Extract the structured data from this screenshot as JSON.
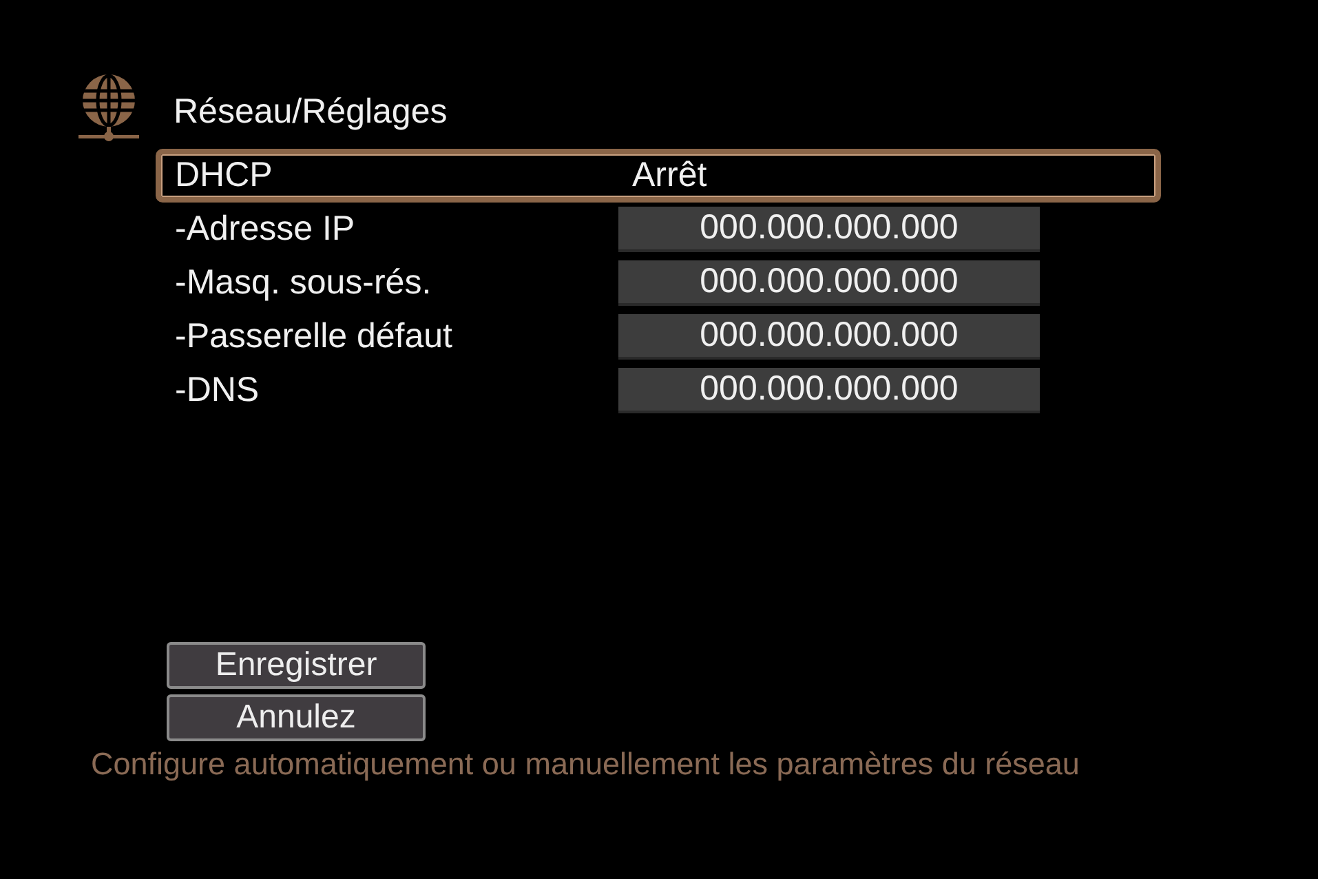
{
  "header": {
    "title": "Réseau/Réglages"
  },
  "rows": [
    {
      "label": "DHCP",
      "value": "Arrêt",
      "kind": "text",
      "selected": true
    },
    {
      "label": "-Adresse IP",
      "value": "000.000.000.000",
      "kind": "field",
      "selected": false
    },
    {
      "label": "-Masq. sous-rés.",
      "value": "000.000.000.000",
      "kind": "field",
      "selected": false
    },
    {
      "label": "-Passerelle défaut",
      "value": "000.000.000.000",
      "kind": "field",
      "selected": false
    },
    {
      "label": "-DNS",
      "value": "000.000.000.000",
      "kind": "field",
      "selected": false
    }
  ],
  "buttons": [
    "Enregistrer",
    "Annulez"
  ],
  "hint": "Configure automatiquement ou manuellement les paramètres du réseau"
}
